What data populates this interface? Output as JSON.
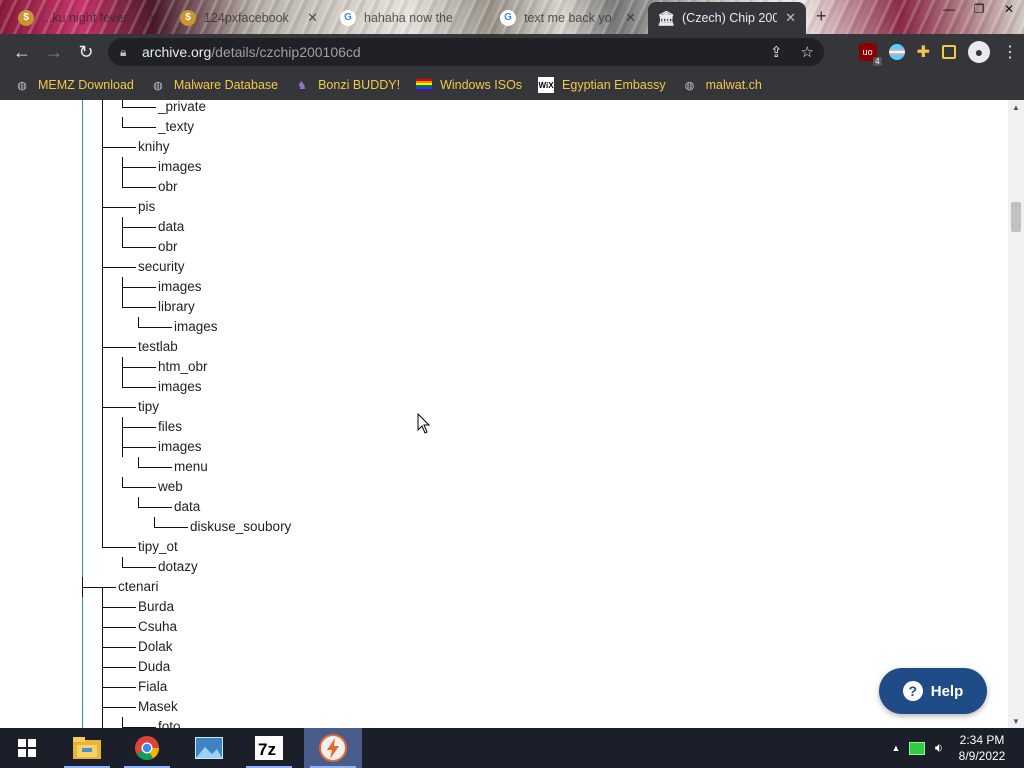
{
  "browser": {
    "tabs": [
      {
        "title": "...ku night fever",
        "close": "✕",
        "favicon": "gold-coin-icon",
        "active": false
      },
      {
        "title": "124pxfacebook",
        "close": "✕",
        "favicon": "gold-coin-icon",
        "active": false
      },
      {
        "title": "hahaha now the",
        "close": "",
        "favicon": "google-g-icon",
        "active": false
      },
      {
        "title": "text me back yo",
        "close": "✕",
        "favicon": "google-g-icon",
        "active": false
      },
      {
        "title": "(Czech) Chip 200",
        "close": "✕",
        "favicon": "archive-org-icon",
        "active": true
      }
    ],
    "new_tab": "+",
    "address": {
      "host": "archive.org",
      "path": "/details/czchip200106cd"
    },
    "extension_badge": "4"
  },
  "bookmarks": [
    {
      "label": "MEMZ Download",
      "icon": "globe-icon"
    },
    {
      "label": "Malware Database",
      "icon": "globe-icon"
    },
    {
      "label": "Bonzi BUDDY!",
      "icon": "bonzi-icon"
    },
    {
      "label": "Windows ISOs",
      "icon": "rainbow-flag-icon"
    },
    {
      "label": "Egyptian Embassy",
      "icon": "wix-icon"
    },
    {
      "label": "malwat.ch",
      "icon": "globe-icon"
    }
  ],
  "tree": {
    "lines": [
      "_private",
      "_texty",
      "knihy",
      "images",
      "obr",
      "pis",
      "data",
      "obr",
      "security",
      "images",
      "library",
      "images",
      "testlab",
      "htm_obr",
      "images",
      "tipy",
      "files",
      "images",
      "menu",
      "web",
      "data",
      "diskuse_soubory",
      "tipy_ot",
      "dotazy",
      "ctenari",
      "Burda",
      "Csuha",
      "Dolak",
      "Duda",
      "Fiala",
      "Masek",
      "foto"
    ]
  },
  "help_button": {
    "label": "Help"
  },
  "taskbar": {
    "time": "2:34 PM",
    "date": "8/9/2022",
    "apps": [
      "windows-start-icon",
      "file-explorer-icon",
      "chrome-icon",
      "photos-icon",
      "7zip-icon",
      "app-lightning-icon"
    ]
  },
  "colors": {
    "tab_active": "#35363a",
    "toolbar": "#35363a",
    "bookmark_text": "#f2c94c",
    "help_bg": "#1f4b86",
    "taskbar": "#1b1f2a"
  }
}
